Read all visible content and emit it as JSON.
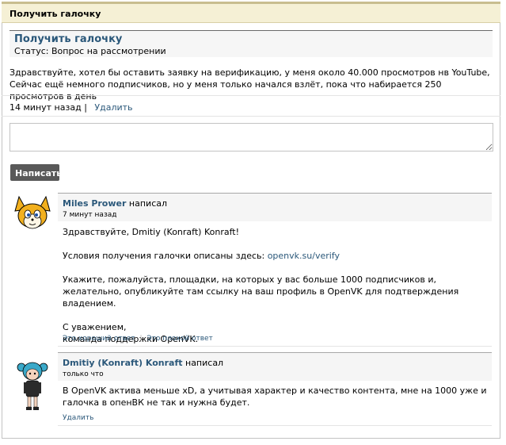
{
  "header": {
    "title": "Получить галочку"
  },
  "ticket": {
    "title": "Получить галочку",
    "status": "Статус: Вопрос на рассмотрении",
    "body": "Здравствуйте, хотел бы оставить заявку на верификацию, у меня около 40.000 просмотров нв YouTube, Сейчас ещё немного подписчиков, но у меня только начался взлёт, пока что набирается 250 просмотров в день",
    "time": "14 минут назад",
    "separator": "|",
    "delete_label": "Удалить"
  },
  "reply": {
    "placeholder": "",
    "submit_label": "Написать"
  },
  "comments": [
    {
      "author": "Miles Prower",
      "wrote": "написал",
      "time": "7 минут назад",
      "lines": {
        "greeting": "Здравствуйте, Dmitiy (Konraft) Konraft!",
        "conditions_prefix": "Условия получения галочки описаны здесь: ",
        "conditions_link": "openvk.su/verify",
        "instructions": "Укажите, пожалуйста, площадки, на которых у вас больше 1000 подписчиков и, желательно, опубликуйте там ссылку на ваш профиль в OpenVK для подтверждения владением.",
        "regards": "С уважением,",
        "signature": "команда поддержки OpenVK."
      },
      "good_label": "Это хороший ответ",
      "action_sep": "|",
      "bad_label": "Это плохой ответ"
    },
    {
      "author": "Dmitiy (Konraft) Konraft",
      "wrote": "написал",
      "time": "только что",
      "text": "В OpenVK актива меньше xD, а учитывая характер и качество контента, мне на 1000 уже и галочка в опенВК не так и нужна будет.",
      "delete_label": "Удалить"
    }
  ],
  "colors": {
    "link": "#2b587a",
    "header_bg": "#f5f0d5",
    "button": "#595959"
  },
  "icons": [
    "fox-avatar-icon",
    "girl-avatar-icon"
  ]
}
